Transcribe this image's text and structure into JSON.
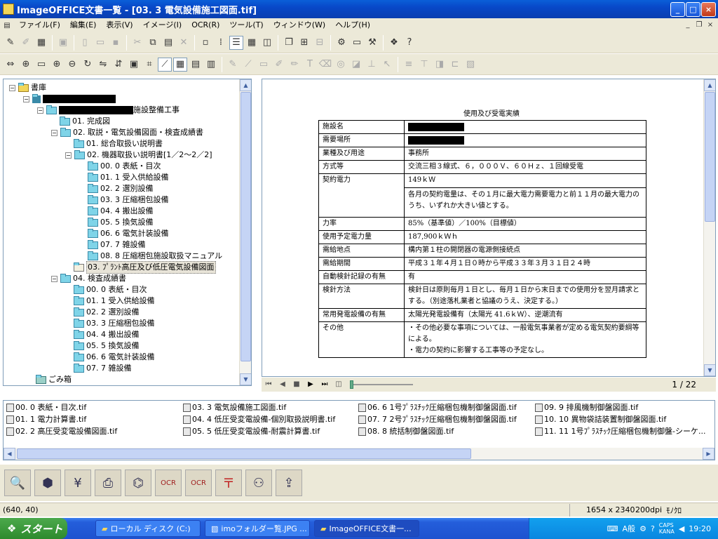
{
  "window": {
    "title": "ImageOFFICE文書一覧 - [03. 3 電気設備施工図面.tif]",
    "min": "_",
    "max": "□",
    "close": "×"
  },
  "menu": [
    "ファイル(F)",
    "編集(E)",
    "表示(V)",
    "イメージ(I)",
    "OCR(R)",
    "ツール(T)",
    "ウィンドウ(W)",
    "ヘルプ(H)"
  ],
  "tree": {
    "root": "書庫",
    "project_suffix": "施設整備工事",
    "items": [
      "01. 完成図",
      "02. 取説・電気設備図面・検査成績書",
      "01. 総合取扱い説明書",
      "02. 機器取扱い説明書[1／2〜2／2]",
      "00. 0 表紙・目次",
      "01. 1 受入供給設備",
      "02. 2 選別設備",
      "03. 3 圧縮梱包設備",
      "04. 4 搬出設備",
      "05. 5 換気設備",
      "06. 6 電気計装設備",
      "07. 7 雑設備",
      "08. 8 圧縮梱包施設取扱マニュアル",
      "03. ﾌﾟﾗﾝﾄ高圧及び低圧電気設備図面",
      "04. 検査成績書",
      "00. 0 表紙・目次",
      "01. 1 受入供給設備",
      "02. 2 選別設備",
      "03. 3 圧縮梱包設備",
      "04. 4 搬出設備",
      "05. 5 換気設備",
      "06. 6 電気計装設備",
      "07. 7 雑設備"
    ],
    "trash": "ごみ箱"
  },
  "document": {
    "heading": "使用及び受電実績",
    "rows": [
      {
        "k": "施設名",
        "v": ""
      },
      {
        "k": "需要場所",
        "v": ""
      },
      {
        "k": "業種及び用途",
        "v": "事務所"
      },
      {
        "k": "方式等",
        "v": "交流三相３線式、６，０００Ｖ、６０Ｈｚ、１回線受電"
      },
      {
        "k": "契約電力",
        "v": "149ｋＷ",
        "v2": "各月の契約電量は、その１月に最大電力需要電力と前１１月の最大電力のうち、いずれか大きい値とする。"
      },
      {
        "k": "力率",
        "v": "85%（基準値）／100%（目標値）"
      },
      {
        "k": "使用予定電力量",
        "v": "187,900ｋＷｈ"
      },
      {
        "k": "需給地点",
        "v": "構内第１柱の開閉器の電源側接続点"
      },
      {
        "k": "需給期間",
        "v": "平成３１年４月１日０時から平成３３年３月３１日２４時"
      },
      {
        "k": "自動検針記録の有無",
        "v": "有"
      },
      {
        "k": "検針方法",
        "v": "検針日は原則毎月１日とし、毎月１日から末日までの使用分を翌月請求とする。（別途落札業者と協議のうえ、決定する。）"
      },
      {
        "k": "常用発電設備の有無",
        "v": "太陽光発電設備有（太陽光 41.6ｋＷ）、逆潮流有"
      },
      {
        "k": "その他",
        "v": "・その他必要な事項については、一般電気事業者が定める電気契約要綱等による。",
        "v2": "・電力の契約に影響する工事等の予定なし。"
      }
    ]
  },
  "nav": {
    "page": "1 / 22"
  },
  "files": [
    "00. 0 表紙・目次.tif",
    "01. 1 電力計算書.tif",
    "02. 2 高圧受変電設備図面.tif",
    "03. 3 電気設備施工図面.tif",
    "04. 4 低圧受変電設備-個別取扱説明書.tif",
    "05. 5 低圧受変電設備-耐震計算書.tif",
    "06. 6 1号ﾌﾟﾗｽﾁｯｸ圧縮梱包機制御盤図面.tif",
    "07. 7 2号ﾌﾟﾗｽﾁｯｸ圧縮梱包機制御盤図面.tif",
    "08. 8 統括制御盤図面.tif",
    "09. 9 排風機制御盤図面.tif",
    "10. 10 異物袋詰装置制御盤図面.tif",
    "11. 11 1号ﾌﾟﾗｽﾁｯｸ圧縮梱包機制御盤-シーケ..."
  ],
  "status": {
    "coords": "(640, 40)",
    "size": "1654 x 2340",
    "dpi": "200dpi",
    "mode": "ﾓﾉｸﾛ"
  },
  "taskbar": {
    "start": "スタート",
    "tasks": [
      "ローカル ディスク (C:)",
      "imoフォルダー覧.JPG ...",
      "ImageOFFICE文書一..."
    ],
    "ime": "A般",
    "caps": "CAPS",
    "kana": "KANA",
    "clock": "19:20"
  }
}
